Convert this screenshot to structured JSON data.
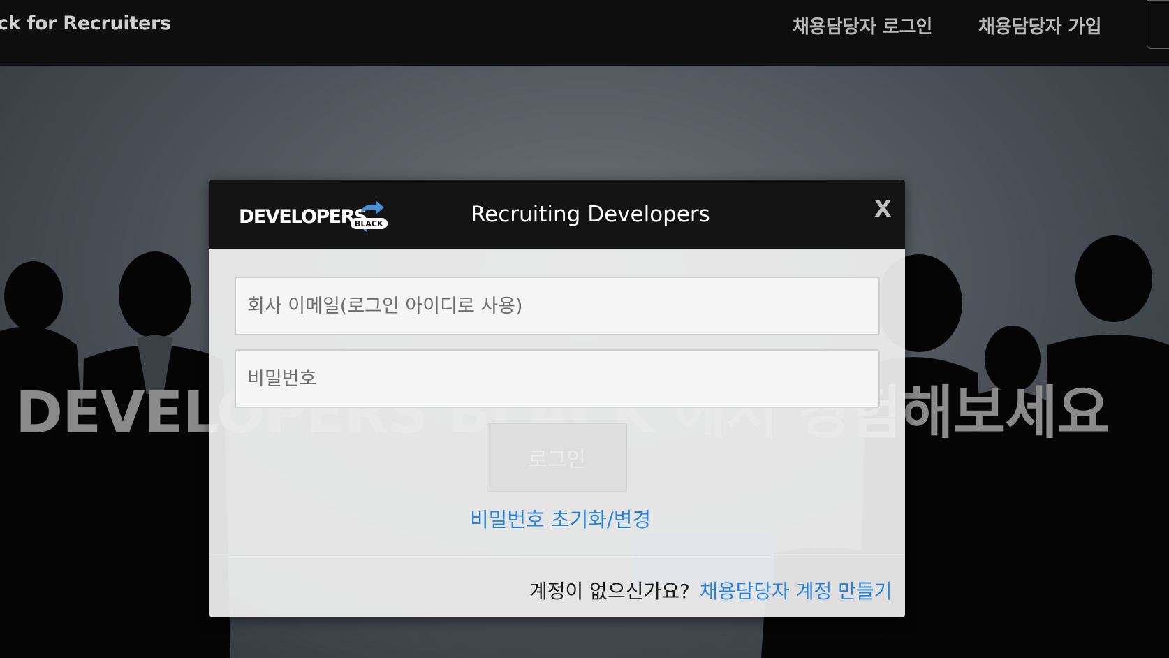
{
  "nav": {
    "brand": "ck for Recruiters",
    "login_label": "채용담당자 로그인",
    "signup_label": "채용담당자 가입"
  },
  "hero": {
    "headline": "DEVELOPERS BLACK 에서 경험해보세요"
  },
  "modal": {
    "logo_text": "DEVELOPERS",
    "logo_badge": "BLACK",
    "title": "Recruiting Developers",
    "close_label": "X",
    "email_placeholder": "회사 이메일(로그인 아이디로 사용)",
    "password_placeholder": "비밀번호",
    "login_button": "로그인",
    "reset_link": "비밀번호 초기화/변경",
    "no_account_text": "계정이 없으신가요?",
    "create_account_link": "채용담당자 계정 만들기"
  },
  "colors": {
    "nav_bg": "#0e0e0e",
    "modal_header_bg": "#141414",
    "link_blue": "#2a83d9",
    "cta_blue": "#1d4a93"
  },
  "icons": [
    "logo-arrows-icon",
    "close-icon"
  ]
}
